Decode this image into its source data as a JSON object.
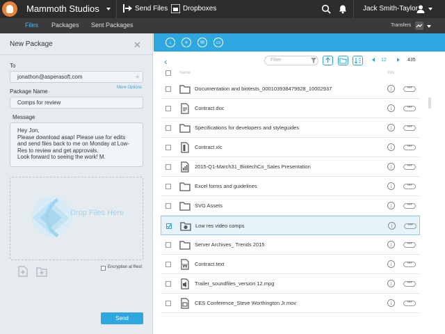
{
  "topbar": {
    "app_title": "Mammoth Studios",
    "send_files": "Send Files",
    "dropboxes": "Dropboxes",
    "user_name": "Jack Smith-Taylor"
  },
  "subbar": {
    "tabs": [
      "Files",
      "Packages",
      "Sent Packages"
    ],
    "active_tab": "Files",
    "transfers": "Transfers"
  },
  "package": {
    "title": "New Package",
    "to_label": "To",
    "to_value": "jonathon@asperasoft.com",
    "more_options": "More Options",
    "name_label": "Package Name",
    "name_value": "Comps for review",
    "message_label": "Message",
    "message_value": "Hey Jon,\nPlease download asap! Please use for edits and send files back to me on Monday at Low-Res to review and get approvals.\nLook forward to seeing the work! M.",
    "drop_text": "Drop Files Here",
    "encryption_label": "Encryption at Rest",
    "send_label": "Send"
  },
  "files": {
    "filter_placeholder": "Filter",
    "page": "12",
    "total": "435",
    "col_name": "Name",
    "col_info": "Info",
    "items": [
      {
        "name": "Documentation and biotests_000103938479928_10002937",
        "type": "folder",
        "checked": false
      },
      {
        "name": "Contract.doc",
        "type": "doc",
        "checked": false
      },
      {
        "name": "Specifications for developers and styleguides",
        "type": "folder",
        "checked": false
      },
      {
        "name": "Contract.xlc",
        "type": "spreadsheet",
        "checked": false
      },
      {
        "name": "2015-Q1-March31_BiotechCo_Sales Presentation",
        "type": "presentation",
        "checked": false
      },
      {
        "name": "Excel forms and guidelines",
        "type": "folder",
        "checked": false
      },
      {
        "name": "SVG Assets",
        "type": "folder",
        "checked": false
      },
      {
        "name": "Low res video comps",
        "type": "video-folder",
        "checked": true
      },
      {
        "name": "Server Archives_ Trends 2015",
        "type": "folder",
        "checked": false
      },
      {
        "name": "Contract.text",
        "type": "word",
        "checked": false
      },
      {
        "name": "Trailer_soundfiles_version 12.mpg",
        "type": "audio",
        "checked": false
      },
      {
        "name": "CES Conference_Steve Worthington Jr.mov",
        "type": "movie",
        "checked": false
      }
    ]
  },
  "colors": {
    "accent": "#2ea7e0",
    "topbar": "#2c2c2c",
    "subbar": "#3a3a3a",
    "panel": "#e6ebef",
    "logo": "#e8823a"
  }
}
